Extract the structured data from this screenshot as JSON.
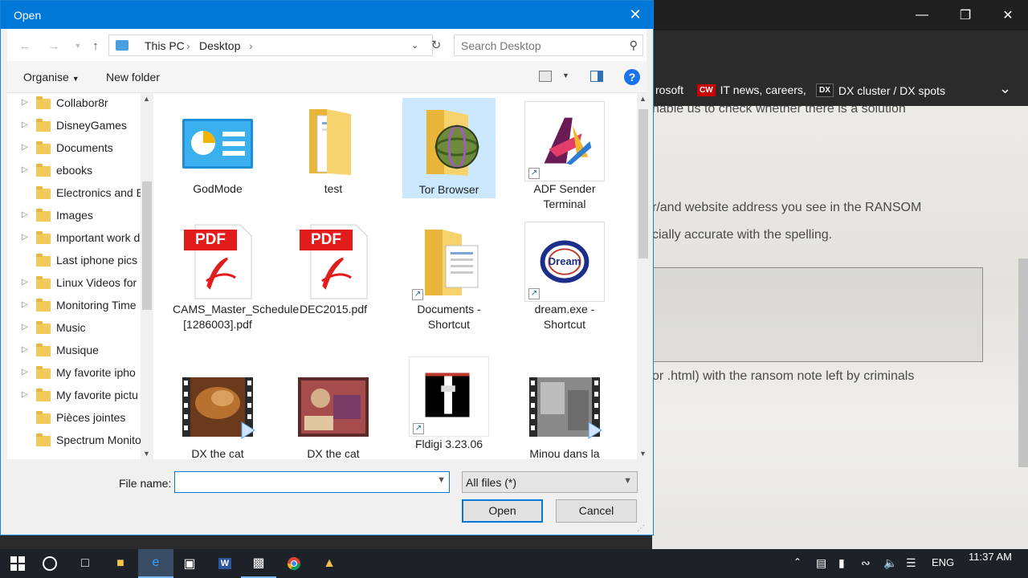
{
  "dialog": {
    "title": "Open",
    "breadcrumb": [
      "This PC",
      "Desktop"
    ],
    "search_placeholder": "Search Desktop",
    "commands": {
      "organise": "Organise",
      "new_folder": "New folder"
    },
    "tree": [
      "Collabor8r",
      "DisneyGames",
      "Documents",
      "ebooks",
      "Electronics and E",
      "Images",
      "Important work d",
      "Last iphone pics",
      "Linux Videos for",
      "Monitoring Time",
      "Music",
      "Musique",
      "My favorite ipho",
      "My favorite pictu",
      "Pièces jointes",
      "Spectrum Monito"
    ],
    "files": [
      {
        "name": "GodMode",
        "icon": "control-panel-icon"
      },
      {
        "name": "test",
        "icon": "folder-icon"
      },
      {
        "name": "Tor Browser",
        "icon": "tor-folder-icon",
        "selected": true
      },
      {
        "name": "ADF Sender Terminal",
        "icon": "adf-logo-icon",
        "shortcut": true
      },
      {
        "name": "CAMS_Master_Schedule [1286003].pdf",
        "icon": "pdf-icon"
      },
      {
        "name": "DEC2015.pdf",
        "icon": "pdf-icon"
      },
      {
        "name": "Documents - Shortcut",
        "icon": "documents-folder-icon",
        "shortcut": true
      },
      {
        "name": "dream.exe - Shortcut",
        "icon": "dream-logo-icon",
        "shortcut": true
      },
      {
        "name": "DX the cat",
        "icon": "video-icon"
      },
      {
        "name": "DX the cat",
        "icon": "video-icon"
      },
      {
        "name": "Fldigi 3.23.06",
        "icon": "fldigi-icon",
        "shortcut": true
      },
      {
        "name": "Minou dans la",
        "icon": "video-icon"
      }
    ],
    "pdf_badge": "PDF",
    "dream_text": "Dream",
    "file_name_label": "File name:",
    "file_name_value": "",
    "file_type": "All files (*)",
    "open_label": "Open",
    "cancel_label": "Cancel"
  },
  "browser": {
    "favorites": [
      {
        "badge": "",
        "label": "rosoft"
      },
      {
        "badge": "CW",
        "label": "IT news, careers,"
      },
      {
        "badge": "DX",
        "label": "DX cluster / DX spots"
      }
    ],
    "page_lines": [
      "nable us to check whether there is a solution",
      "r/and website address you see in the RANSOM",
      "cially accurate with the spelling.",
      "or .html) with the ransom note left by criminals"
    ]
  },
  "taskbar": {
    "language": "ENG",
    "time": "11:37 AM"
  }
}
